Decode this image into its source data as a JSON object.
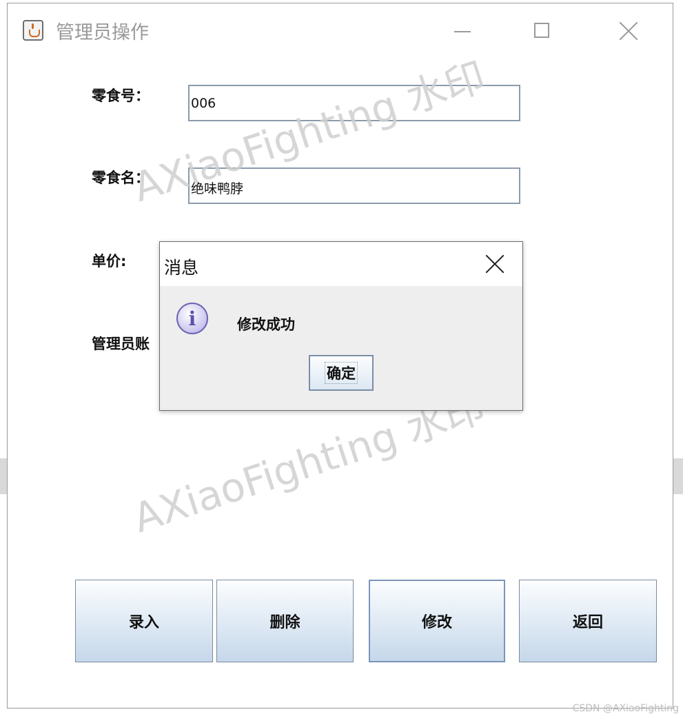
{
  "window": {
    "title": "管理员操作",
    "icon": "java-cup-icon"
  },
  "form": {
    "snack_id_label": "零食号：",
    "snack_id_value": "006",
    "snack_name_label": "零食名：",
    "snack_name_value": "绝味鸭脖",
    "price_label": "单价:",
    "admin_account_label": "管理员账"
  },
  "buttons": {
    "enter": "录入",
    "delete": "删除",
    "modify": "修改",
    "back": "返回"
  },
  "dialog": {
    "title": "消息",
    "icon": "info-icon",
    "message": "修改成功",
    "ok_label": "确定"
  },
  "watermark": {
    "text": "AXiaoFighting 水印"
  },
  "credit": "CSDN @AXiaoFighting"
}
